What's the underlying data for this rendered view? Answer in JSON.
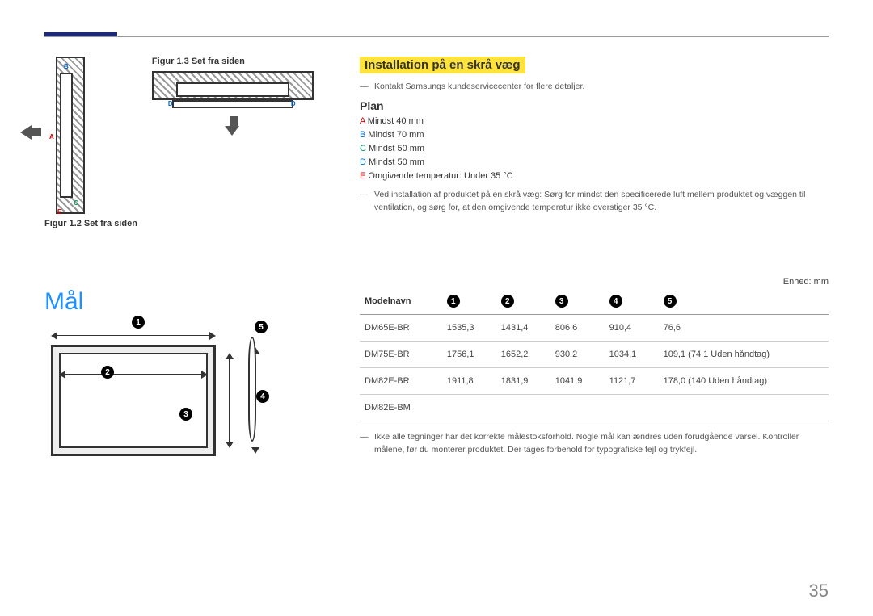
{
  "figures": {
    "fig13_caption": "Figur 1.3 Set fra siden",
    "fig12_caption": "Figur 1.2 Set fra siden",
    "labels": {
      "A": "A",
      "B": "B",
      "C": "C",
      "D": "D",
      "E": "E"
    }
  },
  "install": {
    "heading": "Installation på en skrå væg",
    "note1": "Kontakt Samsungs kundeservicecenter for flere detaljer.",
    "plan_heading": "Plan",
    "specs": {
      "A": "Mindst 40 mm",
      "B": "Mindst 70 mm",
      "C": "Mindst 50 mm",
      "D": "Mindst 50 mm",
      "E": "Omgivende temperatur: Under 35 °C"
    },
    "note2": "Ved installation af produktet på en skrå væg: Sørg for mindst den specificerede luft mellem produktet og væggen til ventilation, og sørg for, at den omgivende temperatur ikke overstiger 35 °C."
  },
  "mal": {
    "title": "Mål",
    "unit": "Enhed: mm",
    "model_header": "Modelnavn",
    "cols": [
      "1",
      "2",
      "3",
      "4",
      "5"
    ],
    "rows": [
      {
        "model": "DM65E-BR",
        "v": [
          "1535,3",
          "1431,4",
          "806,6",
          "910,4",
          "76,6"
        ]
      },
      {
        "model": "DM75E-BR",
        "v": [
          "1756,1",
          "1652,2",
          "930,2",
          "1034,1",
          "109,1 (74,1 Uden håndtag)"
        ]
      },
      {
        "model": "DM82E-BR",
        "v": [
          "1911,8",
          "1831,9",
          "1041,9",
          "1121,7",
          "178,0 (140 Uden håndtag)"
        ]
      },
      {
        "model": "DM82E-BM",
        "v": [
          "",
          "",
          "",
          "",
          ""
        ]
      }
    ],
    "note": "Ikke alle tegninger har det korrekte målestoksforhold. Nogle mål kan ændres uden forudgående varsel. Kontroller målene, før du monterer produktet. Der tages forbehold for typografiske fejl og trykfejl."
  },
  "page_number": "35",
  "chart_data": {
    "type": "table",
    "title": "Mål",
    "unit": "mm",
    "columns": [
      "Modelnavn",
      "1",
      "2",
      "3",
      "4",
      "5"
    ],
    "rows": [
      [
        "DM65E-BR",
        1535.3,
        1431.4,
        806.6,
        910.4,
        76.6
      ],
      [
        "DM75E-BR",
        1756.1,
        1652.2,
        930.2,
        1034.1,
        "109,1 (74,1 Uden håndtag)"
      ],
      [
        "DM82E-BR / DM82E-BM",
        1911.8,
        1831.9,
        1041.9,
        1121.7,
        "178,0 (140 Uden håndtag)"
      ]
    ]
  }
}
